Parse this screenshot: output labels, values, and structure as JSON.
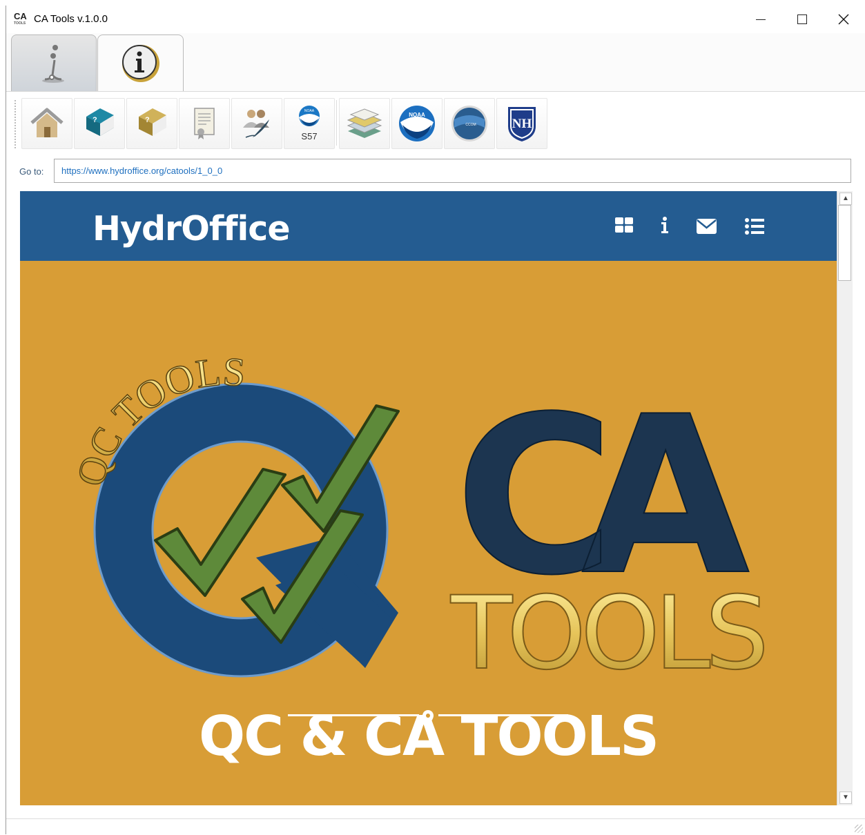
{
  "window": {
    "title": "CA Tools v.1.0.0",
    "icon_text": "CA",
    "icon_sub": "TOOLS",
    "controls": [
      "minimize",
      "maximize",
      "close"
    ]
  },
  "tabs": [
    {
      "icon": "user-manual-icon",
      "selected": true
    },
    {
      "icon": "info-icon",
      "selected": false
    }
  ],
  "toolbar": {
    "buttons": [
      {
        "icon": "home-icon"
      },
      {
        "icon": "blue-help-book-icon"
      },
      {
        "icon": "yellow-help-book-icon"
      },
      {
        "icon": "license-document-icon"
      },
      {
        "icon": "authors-icon"
      },
      {
        "icon": "noaa-s57-icon",
        "label": "S57"
      },
      {
        "icon": "layers-map-icon"
      },
      {
        "icon": "noaa-logo-icon",
        "label": "NOAA"
      },
      {
        "icon": "ccom-jhc-logo-icon"
      },
      {
        "icon": "unh-logo-icon",
        "label": "NH"
      }
    ]
  },
  "address": {
    "label": "Go to:",
    "url": "https://www.hydroffice.org/catools/1_0_0"
  },
  "site": {
    "brand": "HydrOffice",
    "nav_icons": [
      "grid-icon",
      "info-icon",
      "envelope-icon",
      "list-icon"
    ],
    "logo_ring_text": "QC TOOLS",
    "logo_big_text": "CA",
    "logo_tools_text": "TOOLS",
    "headline": "QC & CA TOOLS",
    "colors": {
      "nav": "#245c91",
      "hero": "#d89d36",
      "logo_blue": "#1b4a7a",
      "check_green": "#5e8a3a"
    }
  }
}
